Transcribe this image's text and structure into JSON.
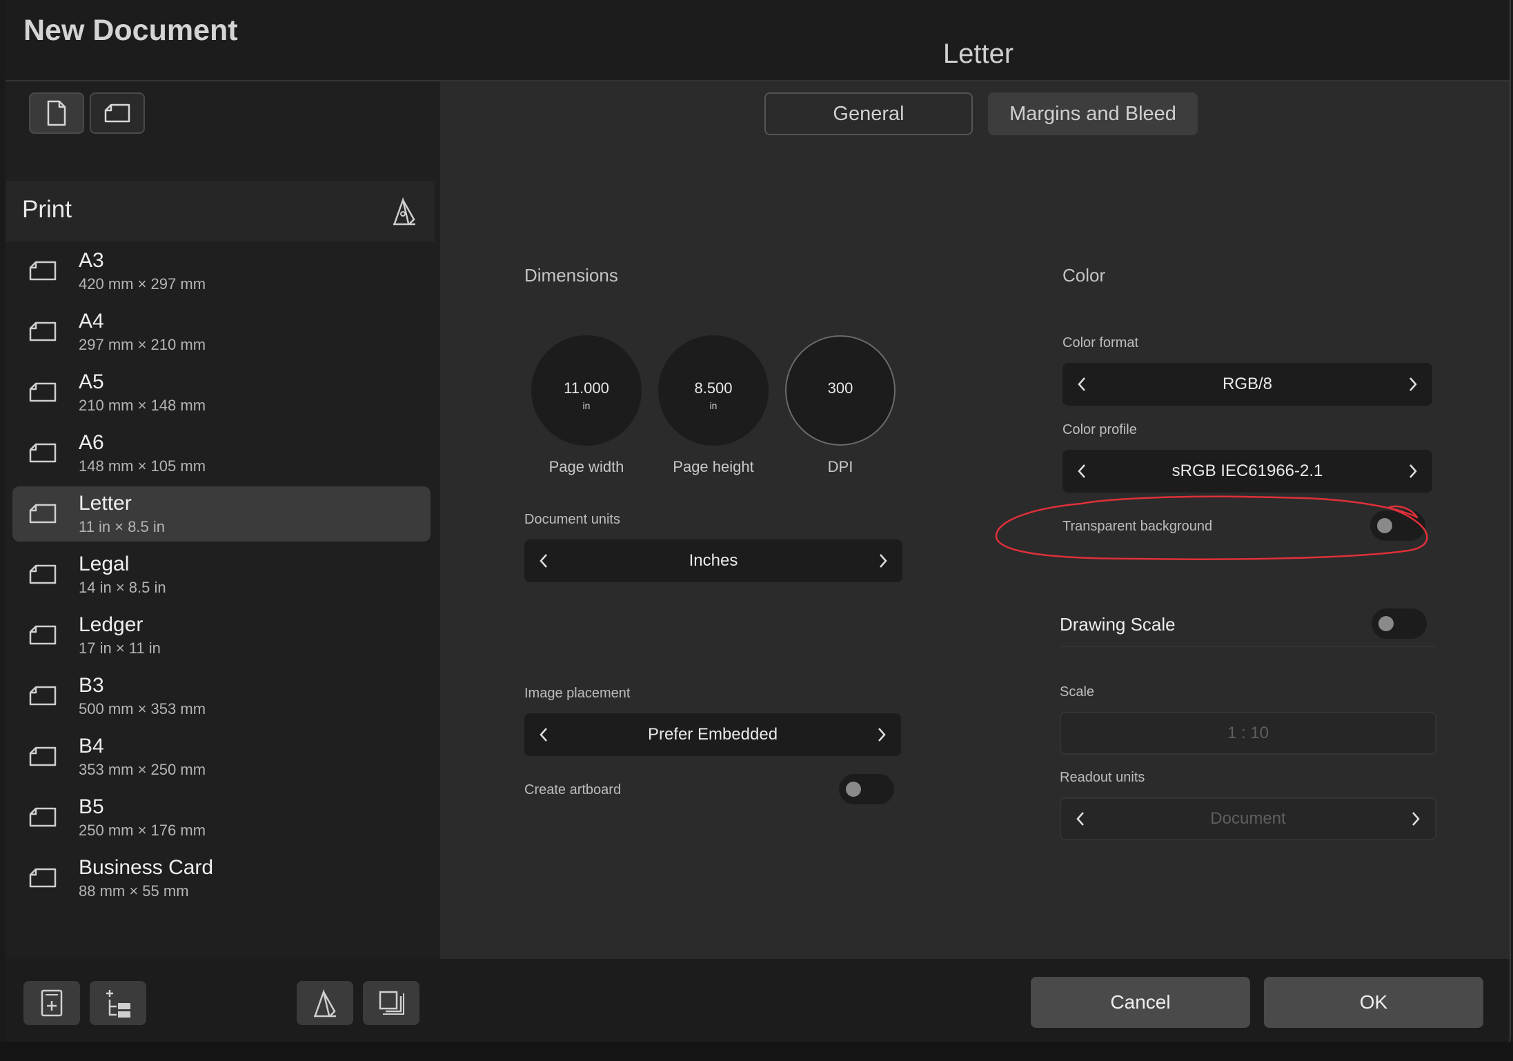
{
  "window": {
    "title": "New Document",
    "preset_name": "Letter"
  },
  "sidebar": {
    "orientation_buttons": [
      {
        "icon": "portrait-page-icon"
      },
      {
        "icon": "landscape-page-icon"
      }
    ],
    "category": "Print",
    "category_icon": "pen-tool-icon",
    "presets": [
      {
        "name": "A3",
        "size": "420 mm × 297 mm"
      },
      {
        "name": "A4",
        "size": "297 mm × 210 mm"
      },
      {
        "name": "A5",
        "size": "210 mm × 148 mm"
      },
      {
        "name": "A6",
        "size": "148 mm × 105 mm"
      },
      {
        "name": "Letter",
        "size": "11 in × 8.5 in",
        "selected": true
      },
      {
        "name": "Legal",
        "size": "14 in × 8.5 in"
      },
      {
        "name": "Ledger",
        "size": "17 in × 11 in"
      },
      {
        "name": "B3",
        "size": "500 mm × 353 mm"
      },
      {
        "name": "B4",
        "size": "353 mm × 250 mm"
      },
      {
        "name": "B5",
        "size": "250 mm × 176 mm"
      },
      {
        "name": "Business Card",
        "size": "88 mm × 55 mm"
      }
    ]
  },
  "tabs": {
    "general": "General",
    "margins": "Margins and Bleed",
    "active": "General"
  },
  "dimensions": {
    "title": "Dimensions",
    "page_width": {
      "value": "11.000",
      "unit": "in",
      "label": "Page width"
    },
    "page_height": {
      "value": "8.500",
      "unit": "in",
      "label": "Page height"
    },
    "dpi": {
      "value": "300",
      "label": "DPI"
    },
    "document_units": {
      "label": "Document units",
      "value": "Inches"
    },
    "image_placement": {
      "label": "Image placement",
      "value": "Prefer Embedded"
    },
    "create_artboard": {
      "label": "Create artboard",
      "on": false
    }
  },
  "color": {
    "title": "Color",
    "format": {
      "label": "Color format",
      "value": "RGB/8"
    },
    "profile": {
      "label": "Color profile",
      "value": "sRGB IEC61966-2.1"
    },
    "transparent_background": {
      "label": "Transparent background",
      "on": false
    },
    "annotation_color": "#e0303a"
  },
  "drawing_scale": {
    "title": "Drawing Scale",
    "on": false,
    "scale": {
      "label": "Scale",
      "value": "1 : 10"
    },
    "readout_units": {
      "label": "Readout units",
      "value": "Document"
    }
  },
  "footer": {
    "left_buttons": [
      "new-page-icon",
      "add-layer-icon"
    ],
    "mid_buttons": [
      "pen-tool-icon",
      "duplicate-icon"
    ],
    "cancel": "Cancel",
    "ok": "OK"
  }
}
